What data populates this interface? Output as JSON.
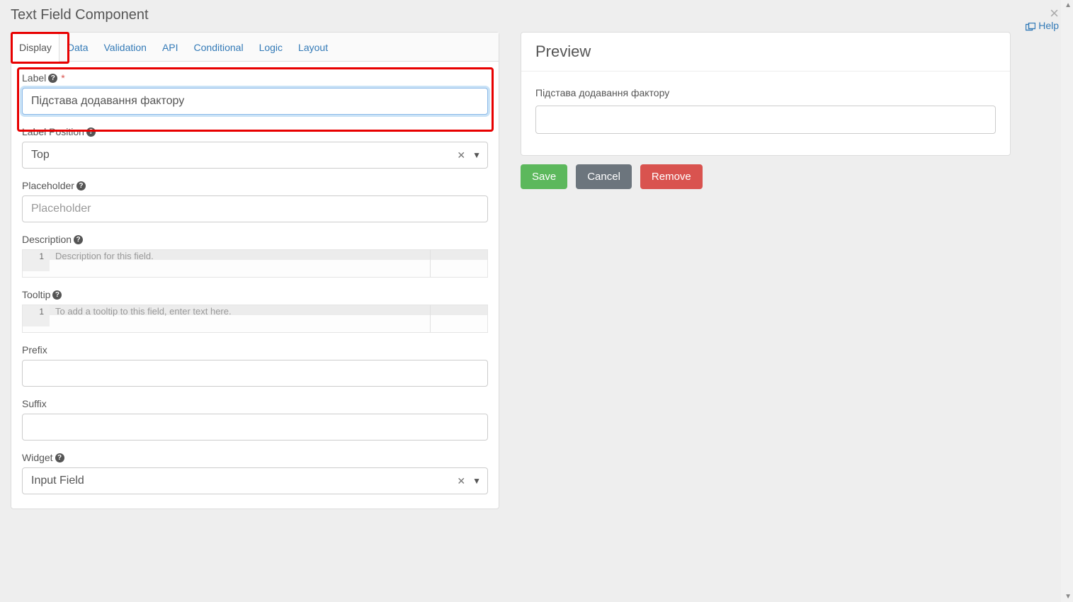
{
  "title": "Text Field Component",
  "help": "Help",
  "tabs": [
    "Display",
    "Data",
    "Validation",
    "API",
    "Conditional",
    "Logic",
    "Layout"
  ],
  "sections": {
    "label": {
      "title": "Label",
      "value": "Підстава додавання фактору"
    },
    "labelPos": {
      "title": "Label Position",
      "value": "Top"
    },
    "placeholder": {
      "title": "Placeholder",
      "ph": "Placeholder"
    },
    "description": {
      "title": "Description",
      "ph": "Description for this field."
    },
    "tooltip": {
      "title": "Tooltip",
      "ph": "To add a tooltip to this field, enter text here."
    },
    "prefix": {
      "title": "Prefix"
    },
    "suffix": {
      "title": "Suffix"
    },
    "widget": {
      "title": "Widget",
      "value": "Input Field"
    }
  },
  "preview": {
    "title": "Preview",
    "fieldLabel": "Підстава додавання фактору"
  },
  "buttons": {
    "save": "Save",
    "cancel": "Cancel",
    "remove": "Remove"
  },
  "codeGutter": "1"
}
